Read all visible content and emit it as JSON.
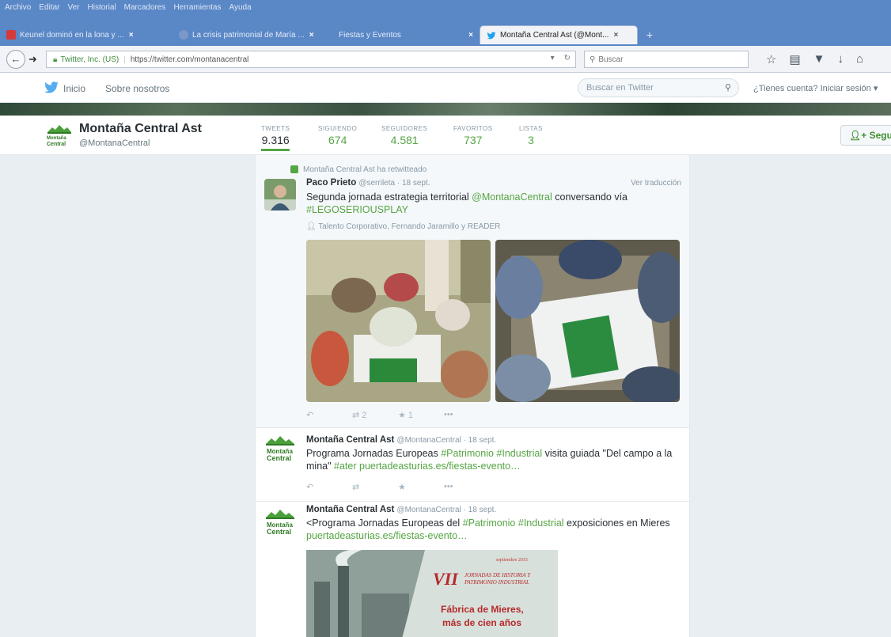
{
  "browser": {
    "menu": [
      "Archivo",
      "Editar",
      "Ver",
      "Historial",
      "Marcadores",
      "Herramientas",
      "Ayuda"
    ],
    "tabs": [
      {
        "title": "Keunel dominó en la lona y ...",
        "fav_color": "#d53a3a",
        "close": "×"
      },
      {
        "title": "La crisis patrimonial de María ...",
        "fav_color": "#7b98c8",
        "close": "×"
      },
      {
        "title": "Fiestas y Eventos",
        "fav_color": "#7b98c8",
        "close": "×"
      },
      {
        "title": "Montaña Central Ast (@Mont... ",
        "fav_color": "#1da1f2",
        "close": "×",
        "active": true
      }
    ],
    "new_tab": "+",
    "site_identity": "Twitter, Inc. (US)",
    "url": "https://twitter.com/montanacentral",
    "search_placeholder": "Buscar"
  },
  "twitter_nav": {
    "home": "Inicio",
    "about": "Sobre nosotros",
    "search_placeholder": "Buscar en Twitter",
    "login": "¿Tienes cuenta? Iniciar sesión ▾"
  },
  "profile": {
    "name": "Montaña Central Ast",
    "handle": "@MontanaCentral",
    "logo_lines": [
      "Montaña",
      "Central"
    ],
    "stats": [
      {
        "label": "TWEETS",
        "value": "9.316"
      },
      {
        "label": "SIGUIENDO",
        "value": "674"
      },
      {
        "label": "SEGUIDORES",
        "value": "4.581"
      },
      {
        "label": "FAVORITOS",
        "value": "737"
      },
      {
        "label": "LISTAS",
        "value": "3"
      }
    ],
    "follow": "Seguir"
  },
  "tweets": [
    {
      "retweet_note": "Montaña Central Ast ha retwitteado",
      "author": "Paco Prieto",
      "meta": "@serrileta · 18 sept.",
      "translate": "Ver traducción",
      "text_parts": [
        "Segunda jornada estrategia territorial ",
        "@MontanaCentral",
        " conversando vía ",
        "#LEGOSERIOUSPLAY"
      ],
      "tagged": "Talento Corporativo, Fernando Jaramillo y READER",
      "retweets": "2",
      "favorites": "1"
    },
    {
      "author": "Montaña Central Ast",
      "meta": "@MontanaCentral · 18 sept.",
      "text_parts": [
        "Programa Jornadas Europeas ",
        "#Patrimonio",
        " ",
        "#Industrial",
        " visita guiada \"Del campo a la mina\" ",
        "#ater",
        " ",
        "puertadeasturias.es/fiestas-evento…"
      ]
    },
    {
      "author": "Montaña Central Ast",
      "meta": "@MontanaCentral · 18 sept.",
      "text_parts": [
        "<Programa Jornadas Europeas del ",
        "#Patrimonio",
        " ",
        "#Industrial",
        " exposiciones en Mieres ",
        "puertadeasturias.es/fiestas-evento…"
      ],
      "poster": {
        "date": "septiembre 2015",
        "numeral": "VII",
        "subtitle_1": "JORNADAS DE HISTORIA Y",
        "subtitle_2": "PATRIMONIO INDUSTRIAL",
        "headline_1": "Fábrica de Mieres,",
        "headline_2": "más de cien años"
      }
    }
  ],
  "colors": {
    "accent": "#55a544",
    "chrome_blue": "#5a87c6",
    "page_bg": "#e9eef2"
  }
}
